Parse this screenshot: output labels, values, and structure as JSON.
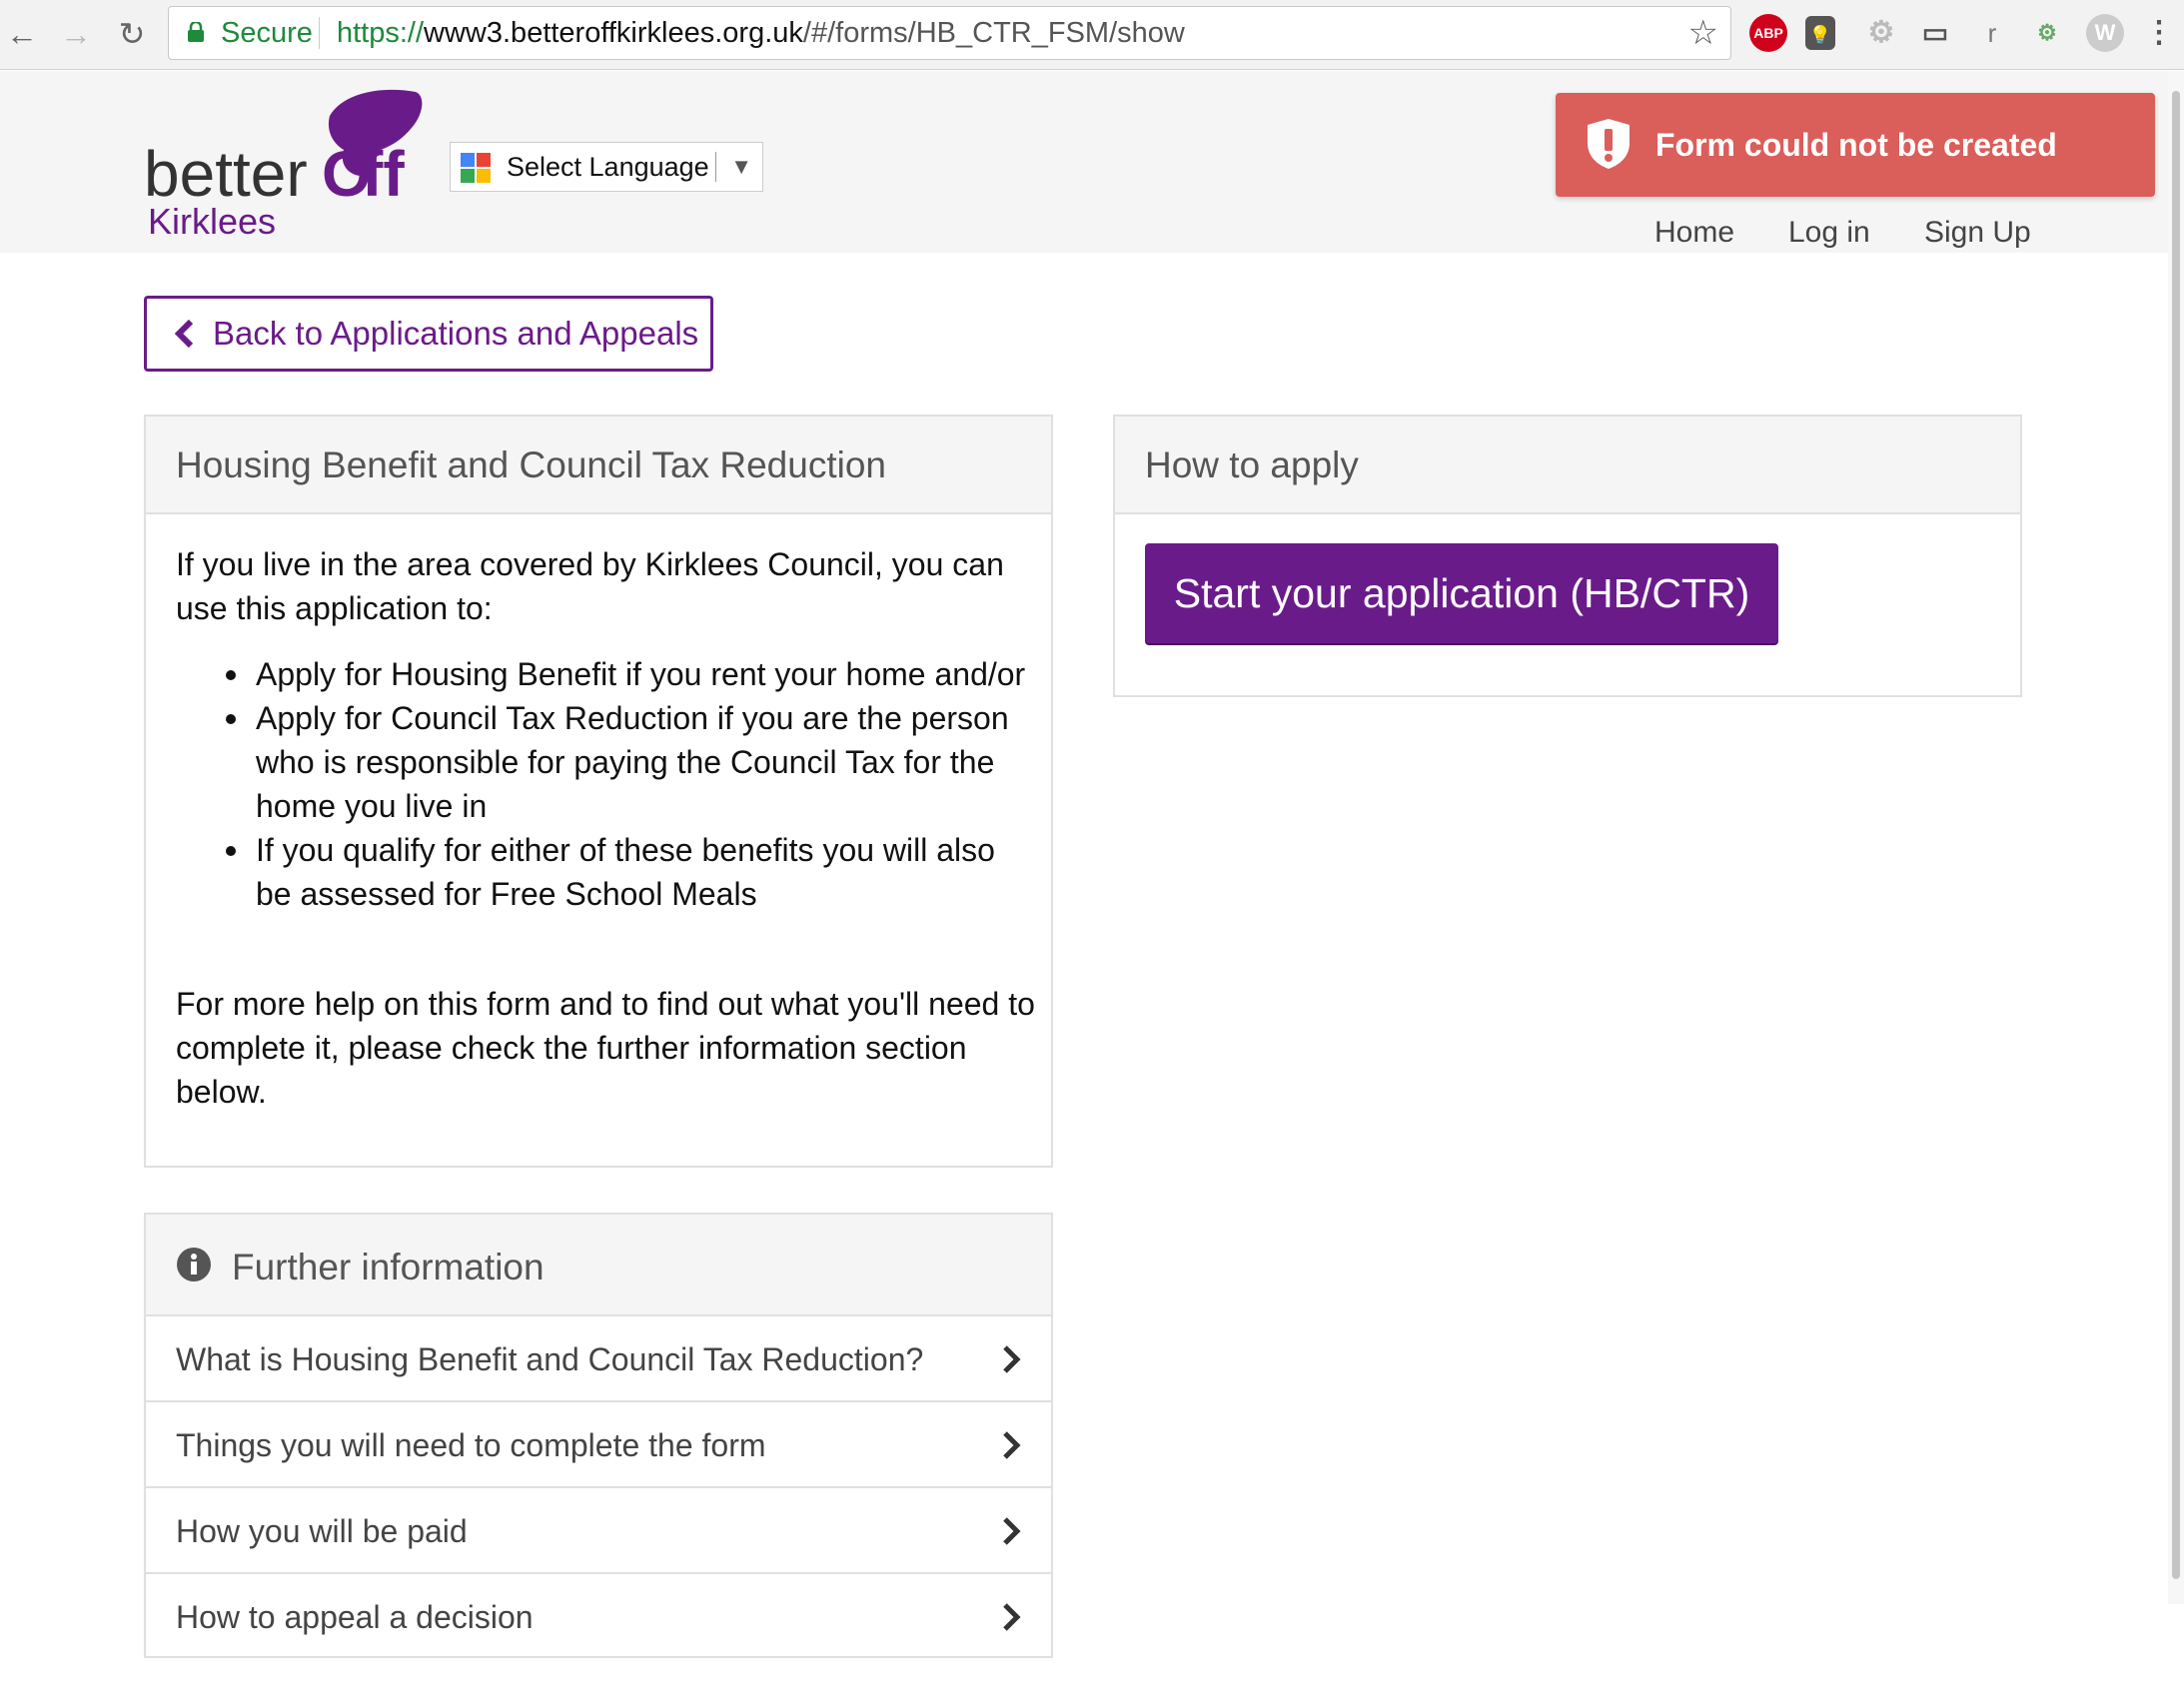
{
  "browser": {
    "secure_label": "Secure",
    "url_scheme": "https://",
    "url_host": "www3.betteroffkirklees.org.uk",
    "url_path": "/#/forms/HB_CTR_FSM/show",
    "extensions": [
      "ABP",
      "r"
    ]
  },
  "header": {
    "logo_word1": "better",
    "logo_word2": "ff",
    "logo_word3": "Kirklees",
    "language_select": "Select Language",
    "nav": [
      "Home",
      "Log in",
      "Sign Up"
    ]
  },
  "toast": {
    "message": "Form could not be created",
    "color": "#d9534f"
  },
  "back_button": "Back to Applications and Appeals",
  "intro_panel": {
    "title": "Housing Benefit and Council Tax Reduction",
    "intro": "If you live in the area covered by Kirklees Council, you can use this application to:",
    "bullets": [
      "Apply for Housing Benefit if you rent your home and/or",
      "Apply for Council Tax Reduction if you are the person who is responsible for paying the Council Tax for the home you live in",
      "If you qualify for either of these benefits you will also be assessed for Free School Meals"
    ],
    "outro": "For more help on this form and to find out what you'll need to complete it, please check the further information section below."
  },
  "apply_panel": {
    "title": "How to apply",
    "button": "Start your application (HB/CTR)"
  },
  "further_info": {
    "title": "Further information",
    "items": [
      "What is Housing Benefit and Council Tax Reduction?",
      "Things you will need to complete the form",
      "How you will be paid",
      "How to appeal a decision"
    ]
  },
  "colors": {
    "brand_purple": "#6a1b8a",
    "secure_green": "#1e8a3c"
  }
}
